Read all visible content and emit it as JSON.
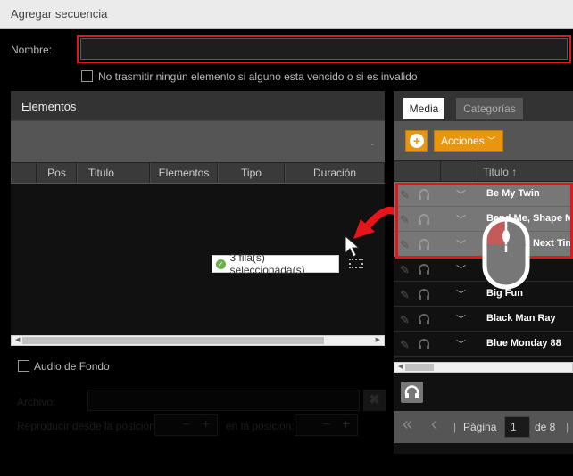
{
  "window": {
    "title": "Agregar secuencia"
  },
  "form": {
    "name_label": "Nombre:",
    "name_value": "",
    "expired_checkbox_label": "No trasmitir ningún elemento si alguno esta vencido o si es invalido",
    "expired_checked": false
  },
  "elements_panel": {
    "title": "Elementos",
    "toolbar_text": "-",
    "columns": [
      "",
      "Pos",
      "Titulo",
      "Elementos",
      "Tipo",
      "Duración"
    ],
    "rows": []
  },
  "toast": {
    "icon": "check-circle-icon",
    "text": "3 fila(s) seleccionada(s)"
  },
  "background_audio": {
    "checkbox_label": "Audio de Fondo",
    "checked": false,
    "file_label": "Archivo:",
    "file_value": "",
    "clear_icon": "close-icon",
    "play_from_label": "Reproducir desde la posición:",
    "at_position_label": "en la posición:",
    "minus": "−",
    "plus": "+"
  },
  "media_panel": {
    "tabs": [
      {
        "label": "Media",
        "active": true
      },
      {
        "label": "Categorías",
        "active": false
      }
    ],
    "add_icon": "plus-circle-icon",
    "actions_label": "Acciones",
    "column_title": "Titulo",
    "sort_indicator": "↑",
    "rows": [
      {
        "title": "Be My Twin",
        "selected": true
      },
      {
        "title": "Bend Me, Shape Me",
        "selected": true
      },
      {
        "title": "Better Be Next Time",
        "selected": true
      },
      {
        "title": "",
        "selected": false
      },
      {
        "title": "Big Fun",
        "selected": false
      },
      {
        "title": "Black Man Ray",
        "selected": false
      },
      {
        "title": "Blue Monday 88",
        "selected": false
      }
    ],
    "pager": {
      "page_label": "Página",
      "current_page": "1",
      "of_label": "de 8",
      "separator": "|"
    }
  },
  "colors": {
    "accent_orange": "#e8950f",
    "annotation_red": "#e8141c",
    "success_green": "#6ab04c"
  }
}
